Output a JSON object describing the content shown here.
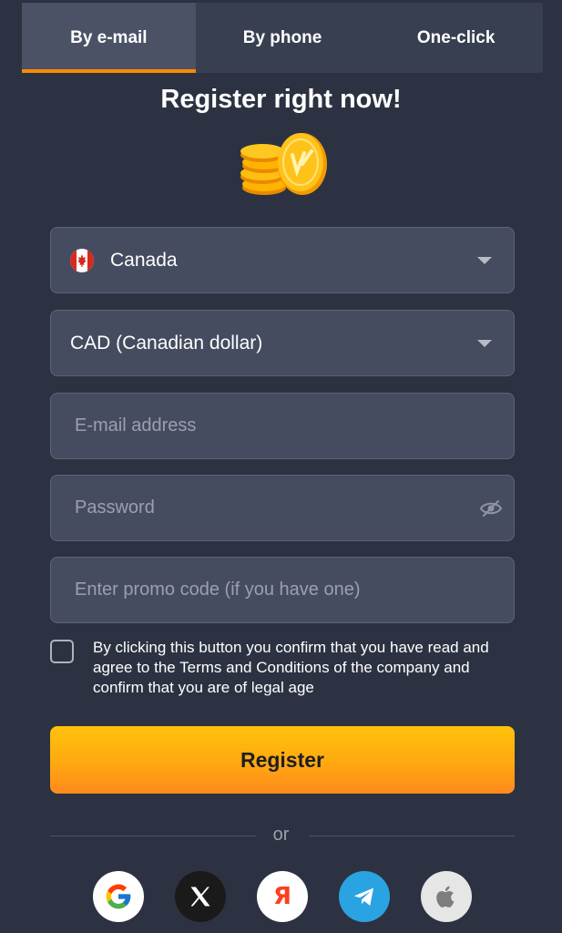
{
  "tabs": [
    {
      "label": "By e-mail",
      "active": true
    },
    {
      "label": "By phone",
      "active": false
    },
    {
      "label": "One-click",
      "active": false
    }
  ],
  "title": "Register right now!",
  "form": {
    "country": {
      "value": "Canada",
      "icon": "canada-flag-icon"
    },
    "currency": {
      "value": "CAD (Canadian dollar)"
    },
    "email": {
      "placeholder": "E-mail address",
      "value": ""
    },
    "password": {
      "placeholder": "Password",
      "value": ""
    },
    "promo": {
      "placeholder": "Enter promo code (if you have one)",
      "value": ""
    },
    "terms_checked": false,
    "terms_text": "By clicking this button you confirm that you have read and agree to the Terms and Conditions of the company and confirm that you are of legal age"
  },
  "register_label": "Register",
  "divider_text": "or",
  "social": [
    {
      "name": "google",
      "icon": "google-icon",
      "bg": "#ffffff"
    },
    {
      "name": "x",
      "icon": "x-icon",
      "bg": "#1a1a1a"
    },
    {
      "name": "yandex",
      "icon": "yandex-icon",
      "bg": "#ffffff",
      "glyph": "Я"
    },
    {
      "name": "telegram",
      "icon": "telegram-icon",
      "bg": "#2aa3e2"
    },
    {
      "name": "apple",
      "icon": "apple-icon",
      "bg": "#e6e6e6"
    }
  ],
  "colors": {
    "background": "#2c3242",
    "tab_bar": "#383f50",
    "tab_active": "#4b5266",
    "accent": "#ff8a00",
    "field_bg": "#464c5f",
    "button_top": "#ffc20a",
    "button_bottom": "#ff8a1d"
  }
}
